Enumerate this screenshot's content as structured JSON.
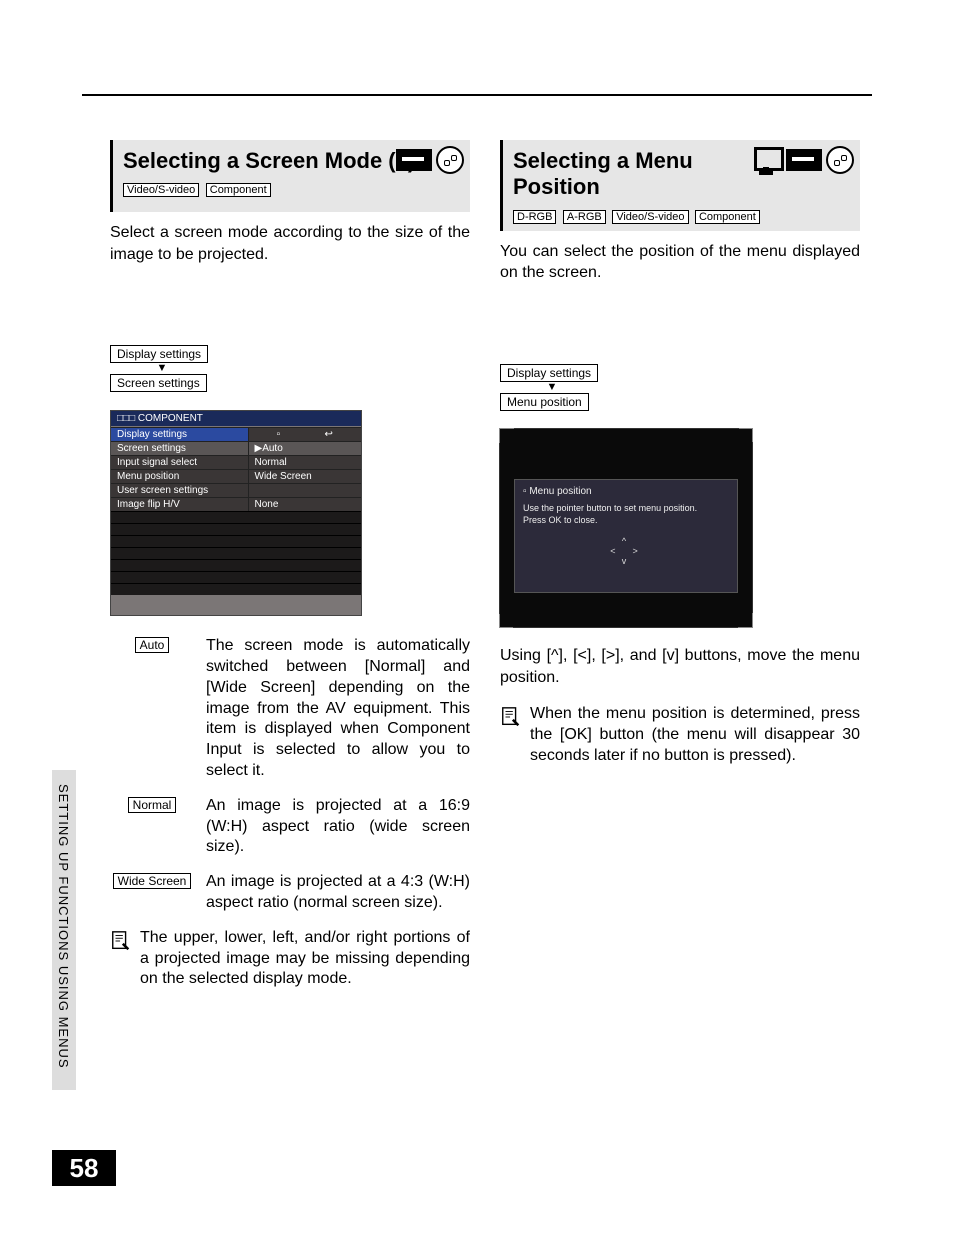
{
  "page_number": "58",
  "side_tab": "SETTING UP FUNCTIONS USING MENUS",
  "left": {
    "title": "Selecting a Screen Mode (2)",
    "tags": [
      "Video/S-video",
      "Component"
    ],
    "lead": "Select a screen mode according to the size of the image to be projected.",
    "breadcrumb": [
      "Display settings",
      "Screen settings"
    ],
    "osd": {
      "header": "□□□ COMPONENT",
      "rows": [
        {
          "l": "Display settings",
          "r": ""
        },
        {
          "l": "Screen settings",
          "r": "▶Auto",
          "sel": true
        },
        {
          "l": "Input signal select",
          "r": "Normal"
        },
        {
          "l": "Menu position",
          "r": "Wide Screen"
        },
        {
          "l": "User screen settings",
          "r": ""
        },
        {
          "l": "Image flip H/V",
          "r": "None"
        }
      ]
    },
    "options": [
      {
        "label": "Auto",
        "text": "The screen mode is automatically switched between [Normal] and [Wide Screen] depending on the image from the AV equipment. This item is displayed when Component Input is selected to allow you to select it."
      },
      {
        "label": "Normal",
        "text": "An image is projected at a 16:9 (W:H) aspect ratio (wide screen size)."
      },
      {
        "label": "Wide Screen",
        "text": "An image is projected at a 4:3 (W:H) aspect ratio (normal screen size)."
      }
    ],
    "note": "The upper, lower, left, and/or right portions of a projected image may be missing depending on the selected display mode."
  },
  "right": {
    "title": "Selecting a Menu Position",
    "tags": [
      "D-RGB",
      "A-RGB",
      "Video/S-video",
      "Component"
    ],
    "lead": "You can select the position of the menu displayed on the screen.",
    "breadcrumb": [
      "Display settings",
      "Menu position"
    ],
    "osd": {
      "title": "Menu position",
      "line1": "Use the pointer button to set menu position.",
      "line2": "Press OK to close."
    },
    "body": "Using [^], [<], [>], and [v] buttons, move the menu position.",
    "note": "When the menu position is determined, press the [OK] button (the menu will disappear 30 seconds later if no button is pressed)."
  }
}
